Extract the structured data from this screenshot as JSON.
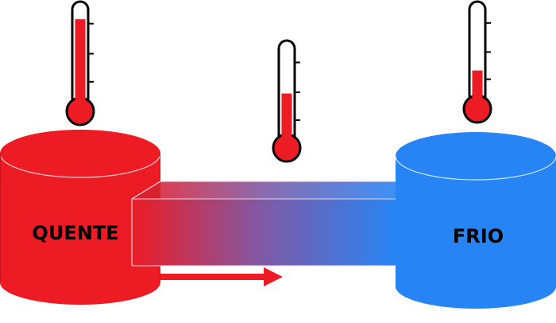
{
  "labels": {
    "hot": "QUENTE",
    "cold": "FRIO"
  },
  "colors": {
    "hot": "#ED1C24",
    "hot_dark": "#C9161D",
    "cold": "#2784F5",
    "cold_dark": "#1E6FD8",
    "bar_mid": "#7E5BA7",
    "arrow": "#ED1C24",
    "mercury": "#ED1C24"
  },
  "thermometers": [
    {
      "name": "hot",
      "level": 0.85
    },
    {
      "name": "middle",
      "level": 0.47
    },
    {
      "name": "cold",
      "level": 0.3
    }
  ],
  "heat_flow_direction": "hot-to-cold"
}
